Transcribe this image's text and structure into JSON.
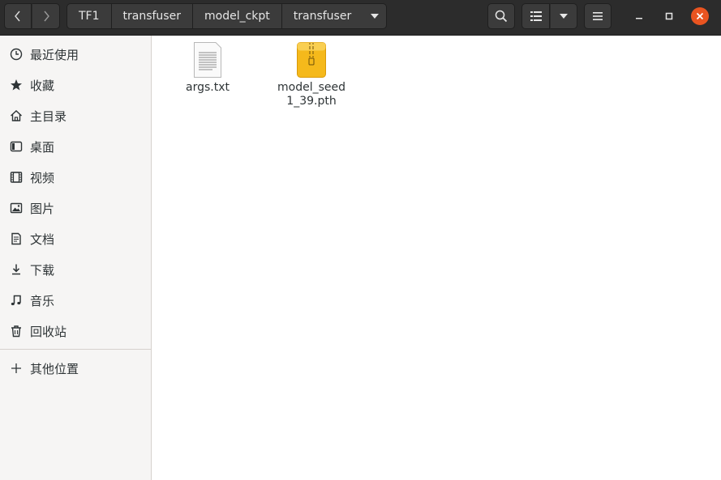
{
  "header": {
    "breadcrumbs": [
      "TF1",
      "transfuser",
      "model_ckpt",
      "transfuser"
    ],
    "icons": {
      "back": "chevron-left-icon",
      "forward": "chevron-right-icon",
      "search": "search-icon",
      "view": "list-view-icon",
      "menu": "hamburger-menu-icon",
      "minimize": "minimize-icon",
      "maximize": "maximize-icon",
      "close": "close-icon"
    },
    "close_color": "#e95420"
  },
  "sidebar": {
    "items": [
      {
        "label": "最近使用",
        "icon": "clock-icon"
      },
      {
        "label": "收藏",
        "icon": "star-icon"
      },
      {
        "label": "主目录",
        "icon": "home-icon"
      },
      {
        "label": "桌面",
        "icon": "desktop-icon"
      },
      {
        "label": "视频",
        "icon": "video-icon"
      },
      {
        "label": "图片",
        "icon": "picture-icon"
      },
      {
        "label": "文档",
        "icon": "document-icon"
      },
      {
        "label": "下载",
        "icon": "download-icon"
      },
      {
        "label": "音乐",
        "icon": "music-icon"
      },
      {
        "label": "回收站",
        "icon": "trash-icon"
      }
    ],
    "other": {
      "label": "其他位置",
      "icon": "plus-icon"
    }
  },
  "files": [
    {
      "name": "args.txt",
      "icon": "text-file-icon"
    },
    {
      "name": "model_seed1_39.pth",
      "icon": "archive-file-icon"
    }
  ]
}
